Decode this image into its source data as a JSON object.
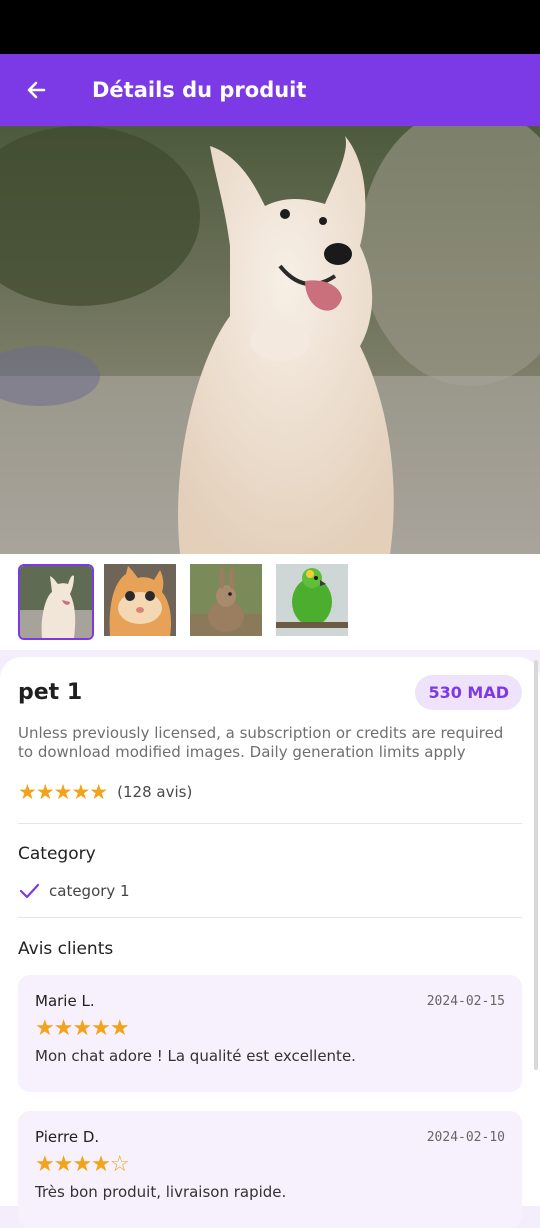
{
  "app_bar": {
    "title": "Détails du produit",
    "back_icon": "arrow-left-icon"
  },
  "hero": {
    "image": "samoyed-dog-photo"
  },
  "thumbnails": [
    {
      "name": "dog",
      "selected": true
    },
    {
      "name": "cat",
      "selected": false
    },
    {
      "name": "rabbit",
      "selected": false
    },
    {
      "name": "parrot",
      "selected": false
    }
  ],
  "product": {
    "name": "pet 1",
    "price": "530 MAD",
    "description": "Unless previously licensed, a subscription or credits are required to download modified images. Daily generation limits apply",
    "rating_stars": "★★★★★",
    "rating_count": "(128 avis)"
  },
  "category": {
    "title": "Category",
    "item": "category 1",
    "icon": "check-icon"
  },
  "reviews": {
    "title": "Avis clients",
    "items": [
      {
        "author": "Marie L.",
        "date": "2024-02-15",
        "stars": "★★★★★",
        "rating": 5,
        "text": "Mon chat adore ! La qualité est excellente."
      },
      {
        "author": "Pierre D.",
        "date": "2024-02-10",
        "stars": "★★★★☆",
        "rating": 4,
        "text": "Très bon produit, livraison rapide."
      }
    ]
  },
  "colors": {
    "accent": "#7b3ae6",
    "star": "#f2a31a",
    "badge_bg": "#efe3fc",
    "card_bg": "#f6f1fd"
  }
}
